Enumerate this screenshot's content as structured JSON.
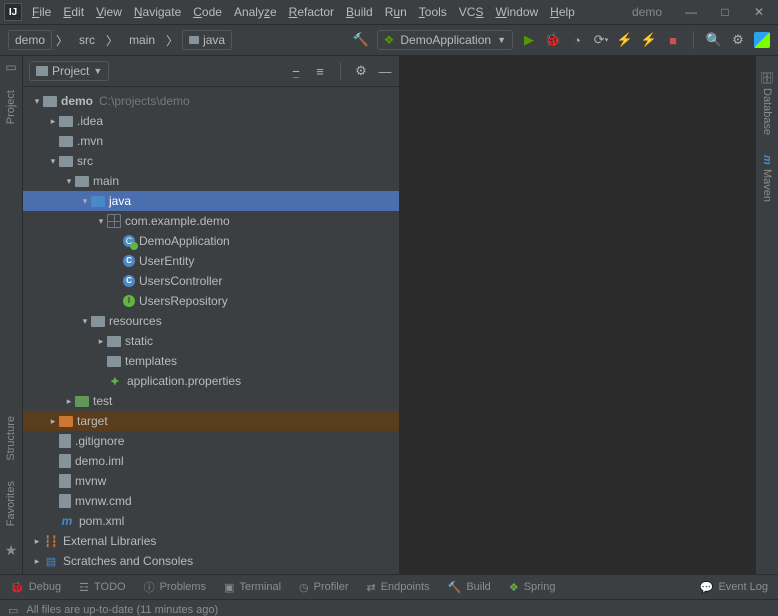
{
  "menu": {
    "items": [
      "File",
      "Edit",
      "View",
      "Navigate",
      "Code",
      "Analyze",
      "Refactor",
      "Build",
      "Run",
      "Tools",
      "VCS",
      "Window",
      "Help"
    ],
    "project": "demo"
  },
  "window": {
    "min": "—",
    "max": "□",
    "close": "✕"
  },
  "breadcrumbs": [
    {
      "label": "demo",
      "boxed": true
    },
    {
      "label": "src"
    },
    {
      "label": "main"
    },
    {
      "label": "java",
      "boxed": true,
      "folder": true
    }
  ],
  "run_config": {
    "label": "DemoApplication"
  },
  "toolbar_icons": [
    "hammer",
    "play",
    "bug",
    "cover",
    "rerun",
    "repl",
    "stopgrey",
    "stopgrp",
    "stop",
    "search",
    "gear",
    "cube"
  ],
  "project_panel": {
    "title": "Project",
    "tools": [
      "select-opened",
      "expand-all",
      "gear",
      "hide"
    ]
  },
  "tree": [
    {
      "d": 0,
      "tw": "v",
      "ic": "proj",
      "label": "demo",
      "dim": "C:\\projects\\demo",
      "bold": true
    },
    {
      "d": 1,
      "tw": ">",
      "ic": "fold",
      "label": ".idea"
    },
    {
      "d": 1,
      "tw": "",
      "ic": "fold",
      "label": ".mvn"
    },
    {
      "d": 1,
      "tw": "v",
      "ic": "fold",
      "label": "src"
    },
    {
      "d": 2,
      "tw": "v",
      "ic": "fold",
      "label": "main"
    },
    {
      "d": 3,
      "tw": "v",
      "ic": "foldb",
      "label": "java",
      "sel": true
    },
    {
      "d": 4,
      "tw": "v",
      "ic": "pkg",
      "label": "com.example.demo"
    },
    {
      "d": 5,
      "tw": "",
      "ic": "spr",
      "label": "DemoApplication"
    },
    {
      "d": 5,
      "tw": "",
      "ic": "cls",
      "label": "UserEntity"
    },
    {
      "d": 5,
      "tw": "",
      "ic": "cls",
      "label": "UsersController"
    },
    {
      "d": 5,
      "tw": "",
      "ic": "intf",
      "label": "UsersRepository"
    },
    {
      "d": 3,
      "tw": "v",
      "ic": "fold",
      "label": "resources"
    },
    {
      "d": 4,
      "tw": ">",
      "ic": "fold",
      "label": "static"
    },
    {
      "d": 4,
      "tw": "",
      "ic": "fold",
      "label": "templates"
    },
    {
      "d": 4,
      "tw": "",
      "ic": "leaf",
      "label": "application.properties"
    },
    {
      "d": 2,
      "tw": ">",
      "ic": "foldt",
      "label": "test"
    },
    {
      "d": 1,
      "tw": ">",
      "ic": "foldo",
      "label": "target",
      "trg": true
    },
    {
      "d": 1,
      "tw": "",
      "ic": "file",
      "label": ".gitignore"
    },
    {
      "d": 1,
      "tw": "",
      "ic": "file",
      "label": "demo.iml"
    },
    {
      "d": 1,
      "tw": "",
      "ic": "file",
      "label": "mvnw"
    },
    {
      "d": 1,
      "tw": "",
      "ic": "file",
      "label": "mvnw.cmd"
    },
    {
      "d": 1,
      "tw": "",
      "ic": "mvn",
      "label": "pom.xml"
    },
    {
      "d": 0,
      "tw": ">",
      "ic": "lib",
      "label": "External Libraries"
    },
    {
      "d": 0,
      "tw": ">",
      "ic": "scr",
      "label": "Scratches and Consoles"
    }
  ],
  "left_rail": [
    "Project",
    "Structure",
    "Favorites"
  ],
  "right_rail": [
    "Database",
    "Maven"
  ],
  "bottom_tools": [
    {
      "icon": "bug",
      "label": "Debug"
    },
    {
      "icon": "todo",
      "label": "TODO"
    },
    {
      "icon": "prob",
      "label": "Problems"
    },
    {
      "icon": "term",
      "label": "Terminal"
    },
    {
      "icon": "prof",
      "label": "Profiler"
    },
    {
      "icon": "endp",
      "label": "Endpoints"
    },
    {
      "icon": "build",
      "label": "Build"
    },
    {
      "icon": "spr",
      "label": "Spring"
    }
  ],
  "event_log": "Event Log",
  "status": {
    "text": "All files are up-to-date (11 minutes ago)"
  }
}
